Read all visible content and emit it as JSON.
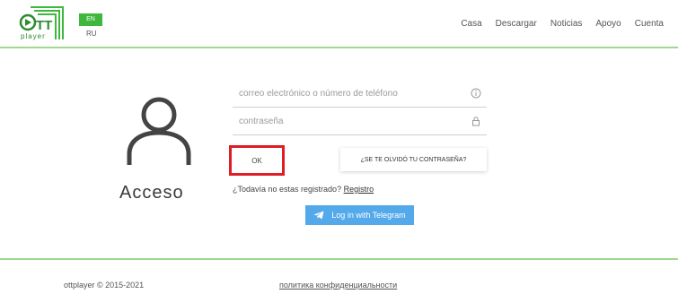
{
  "header": {
    "logo_text": "player",
    "lang_active": "EN",
    "lang_other": "RU",
    "nav": [
      "Casa",
      "Descargar",
      "Noticias",
      "Apoyo",
      "Cuenta"
    ]
  },
  "login": {
    "title": "Acceso",
    "email_placeholder": "correo electrónico o número de teléfono",
    "password_placeholder": "contraseña",
    "ok_label": "OK",
    "forgot_label": "¿SE TE OLVIDÓ TU CONTRASEÑA?",
    "register_prompt": "¿Todavía no estas registrado?",
    "register_link": "Registro",
    "telegram_label": "Log in with Telegram"
  },
  "footer": {
    "copyright": "ottplayer © 2015-2021",
    "policy": "политика конфиденциальности"
  },
  "colors": {
    "brand_green": "#3db83d",
    "divider_green": "#9fd88e",
    "highlight_red": "#e01c24",
    "telegram_blue": "#54a9eb"
  }
}
